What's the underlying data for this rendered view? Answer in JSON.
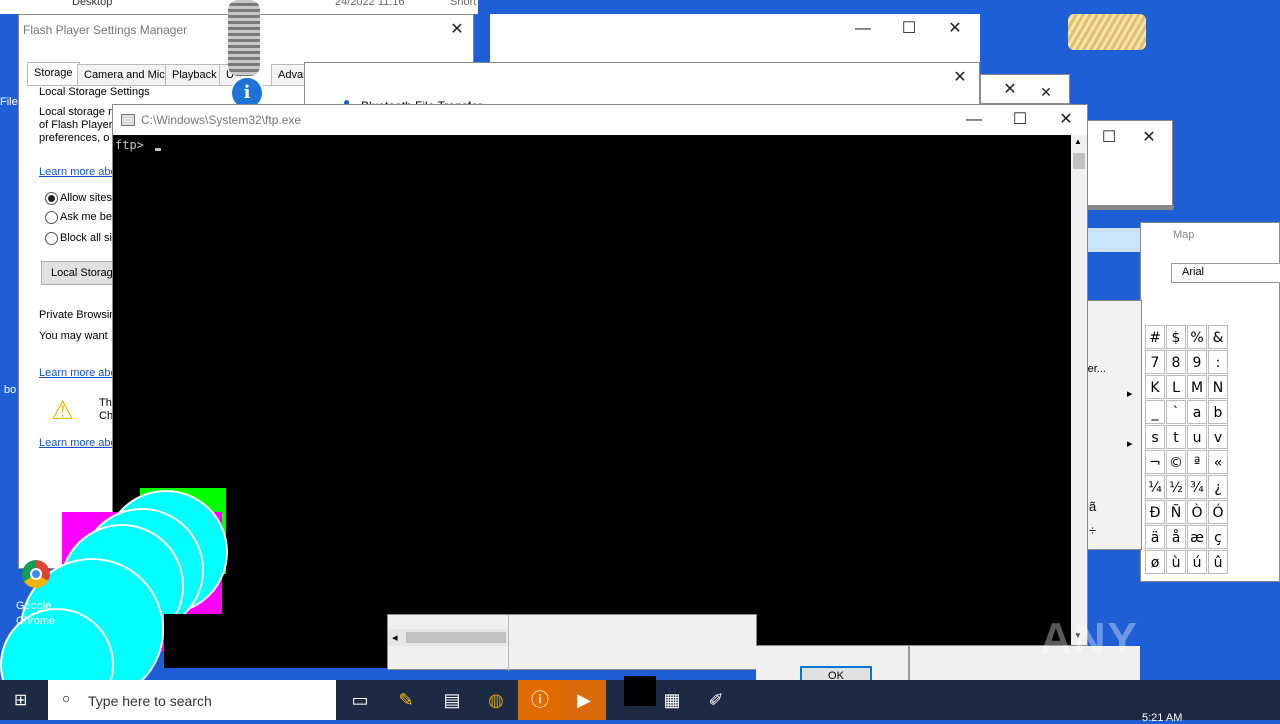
{
  "desktop": {
    "chrome_label_1": "Google",
    "chrome_label_2": "Chrome",
    "side_label": "bo",
    "side_file": "File",
    "watermark": "ANY RUN"
  },
  "explorer_bg": {
    "folder": "Desktop",
    "date": "24/2022 11:16",
    "tail": "Short"
  },
  "flash": {
    "title": "Flash Player Settings Manager",
    "tabs": [
      "Storage",
      "Camera and Mic",
      "Playback",
      "U",
      "Advanced"
    ],
    "section_title": "Local Storage Settings",
    "desc_1": "Local storage m",
    "desc_2": "of Flash Player",
    "desc_3": "preferences, o",
    "learn_more": "Learn more abo",
    "radio_allow": "Allow sites",
    "radio_ask": "Ask me bef",
    "radio_block": "Block all sit",
    "local_storage_button": "Local Storag",
    "private_title": "Private Browsin",
    "private_desc": "You may want",
    "warn_1": "Th",
    "warn_2": "Ch"
  },
  "bluetooth": {
    "title": "Bluetooth File Transfer"
  },
  "ftp": {
    "title": "C:\\Windows\\System32\\ftp.exe",
    "prompt": "ftp>"
  },
  "right_menu": {
    "computer": "omputer...",
    "map": "Map",
    "font": "Arial"
  },
  "charmap": {
    "rows": [
      [
        "#",
        "$",
        "%",
        "&"
      ],
      [
        "7",
        "8",
        "9",
        ":"
      ],
      [
        "K",
        "L",
        "M",
        "N"
      ],
      [
        "_",
        "`",
        "a",
        "b"
      ],
      [
        "s",
        "t",
        "u",
        "v"
      ],
      [
        "¬",
        "©",
        "ª",
        "«"
      ],
      [
        "¼",
        "½",
        "¾",
        "¿"
      ],
      [
        "Ð",
        "Ñ",
        "Ò",
        "Ó"
      ],
      [
        "ä",
        "å",
        "æ",
        "ç"
      ],
      [
        "ø",
        "ù",
        "ú",
        "û"
      ]
    ],
    "partial": [
      "ã",
      "÷"
    ]
  },
  "dialog": {
    "ok": "OK"
  },
  "taskbar": {
    "search_placeholder": "Type here to search",
    "time": "5:21 AM"
  },
  "colors": {
    "desktop": "#1f5fd6",
    "terminal": "#000000",
    "cyan": "#00ffff",
    "magenta": "#ff00ff",
    "green": "#00ff00"
  }
}
